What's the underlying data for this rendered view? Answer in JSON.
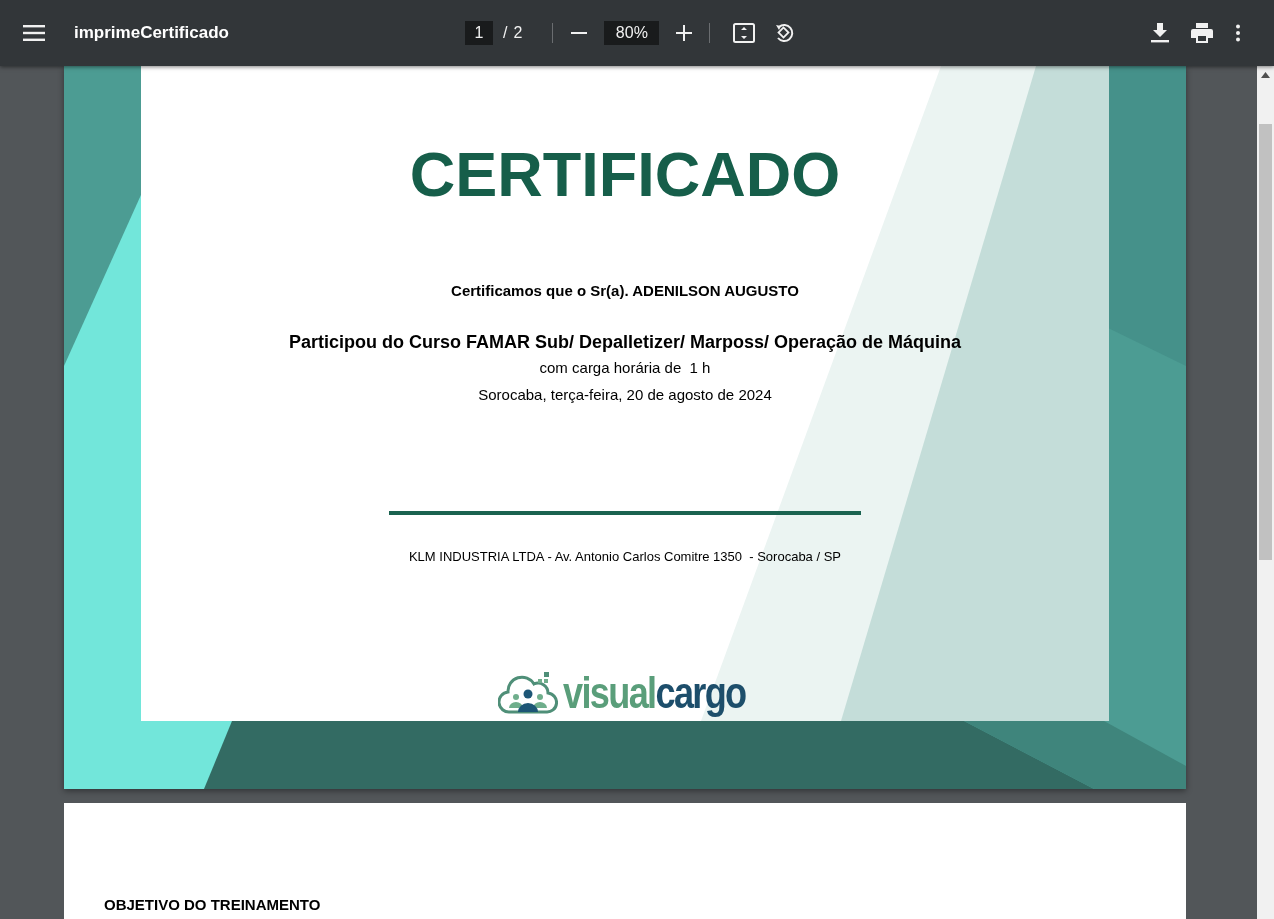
{
  "toolbar": {
    "title": "imprimeCertificado",
    "page_current": "1",
    "page_separator": "/",
    "page_total": "2",
    "zoom": "80%"
  },
  "certificate": {
    "heading": "CERTIFICADO",
    "recipient_line": "Certificamos que o Sr(a). ADENILSON AUGUSTO",
    "course_line": "Participou do Curso FAMAR Sub/ Depalletizer/ Marposs/ Operação de Máquina",
    "workload_line": "com carga horária de  1 h",
    "date_line": "Sorocaba, terça-feira, 20 de agosto de 2024",
    "company_line": "KLM INDUSTRIA LTDA - Av. Antonio Carlos Comitre 1350  - Sorocaba / SP",
    "logo_words": [
      "visual",
      "cargo"
    ]
  },
  "page_2": {
    "section_heading": "OBJETIVO DO TREINAMENTO"
  }
}
